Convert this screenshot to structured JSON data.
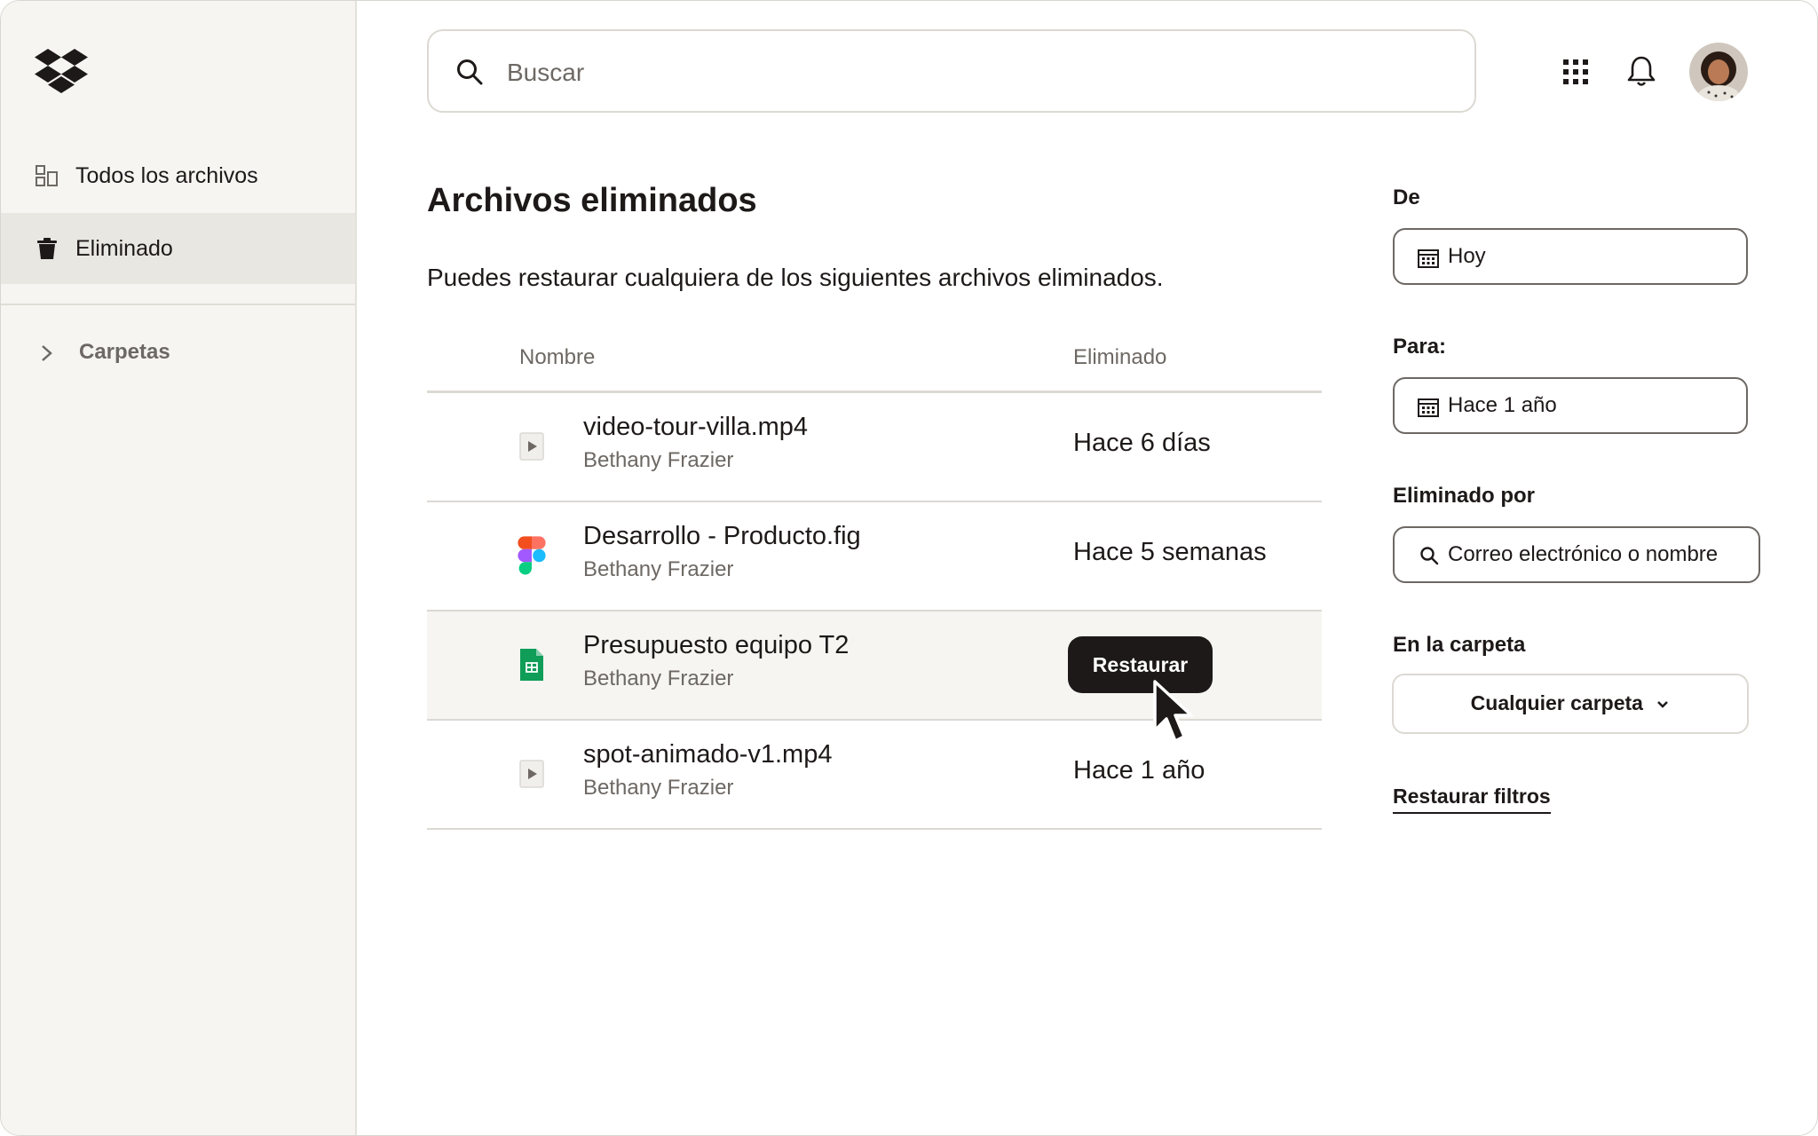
{
  "sidebar": {
    "items": [
      {
        "label": "Todos los archivos",
        "icon": "files-icon"
      },
      {
        "label": "Eliminado",
        "icon": "trash-icon",
        "active": true
      }
    ],
    "folders_label": "Carpetas"
  },
  "search": {
    "placeholder": "Buscar"
  },
  "main": {
    "title": "Archivos eliminados",
    "subtitle": "Puedes restaurar cualquiera de los siguientes archivos eliminados.",
    "columns": {
      "name": "Nombre",
      "deleted": "Eliminado"
    },
    "rows": [
      {
        "name": "video-tour-villa.mp4",
        "owner": "Bethany Frazier",
        "deleted": "Hace 6 días",
        "icon": "video-file-icon"
      },
      {
        "name": "Desarrollo - Producto.fig",
        "owner": "Bethany Frazier",
        "deleted": "Hace 5 semanas",
        "icon": "figma-file-icon"
      },
      {
        "name": "Presupuesto equipo T2",
        "owner": "Bethany Frazier",
        "deleted": "",
        "icon": "spreadsheet-file-icon",
        "hovered": true
      },
      {
        "name": "spot-animado-v1.mp4",
        "owner": "Bethany Frazier",
        "deleted": "Hace 1 año",
        "icon": "video-file-icon"
      }
    ],
    "restore_button": "Restaurar"
  },
  "filters": {
    "from_label": "De",
    "from_value": "Hoy",
    "to_label": "Para:",
    "to_value": "Hace 1 año",
    "deleted_by_label": "Eliminado por",
    "deleted_by_placeholder": "Correo electrónico o nombre",
    "folder_label": "En la carpeta",
    "folder_value": "Cualquier carpeta",
    "reset_link": "Restaurar filtros"
  },
  "colors": {
    "sidebar_bg": "#f6f5f2",
    "active_item_bg": "#e9e7e2",
    "text_primary": "#1e1919",
    "text_secondary": "#6d6863",
    "button_dark": "#1e1919"
  }
}
